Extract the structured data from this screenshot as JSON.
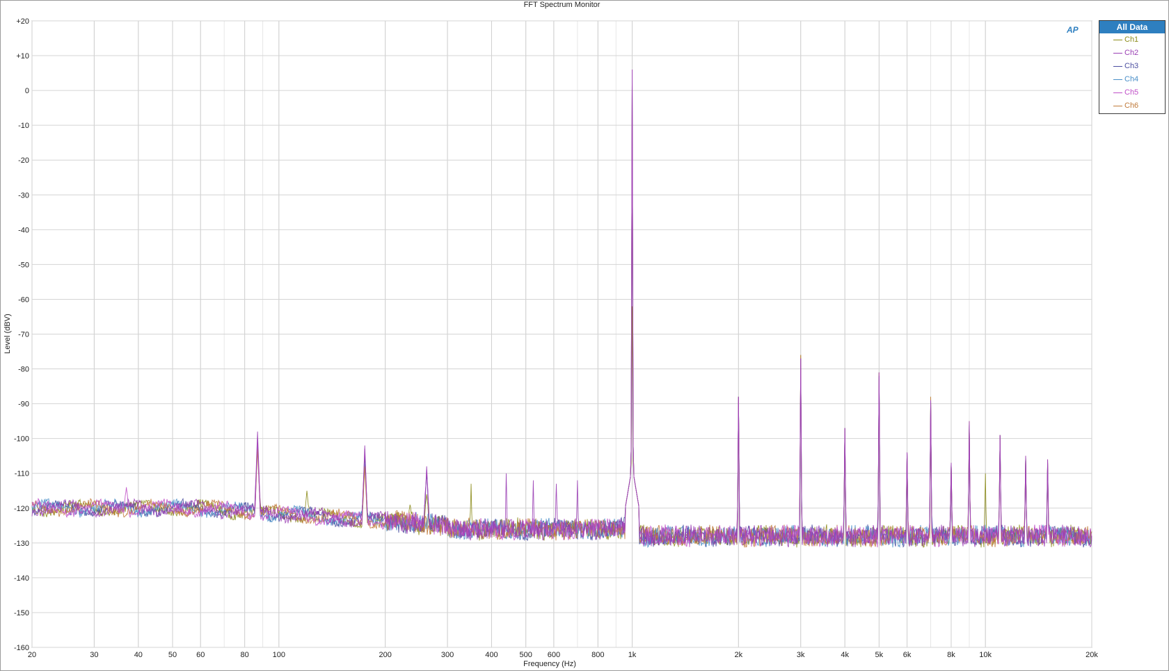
{
  "chart_data": {
    "type": "line",
    "title": "FFT Spectrum Monitor",
    "xlabel": "Frequency (Hz)",
    "ylabel": "Level (dBV)",
    "xscale": "log",
    "xlim": [
      20,
      20000
    ],
    "ylim": [
      -160,
      20
    ],
    "grid": true,
    "x_ticks": [
      20,
      30,
      40,
      50,
      60,
      80,
      100,
      200,
      300,
      400,
      500,
      600,
      800,
      1000,
      2000,
      3000,
      4000,
      5000,
      6000,
      8000,
      10000,
      20000
    ],
    "x_tick_labels": [
      "20",
      "30",
      "40",
      "50",
      "60",
      "80",
      "100",
      "200",
      "300",
      "400",
      "500",
      "600",
      "800",
      "1k",
      "2k",
      "3k",
      "4k",
      "5k",
      "6k",
      "8k",
      "10k",
      "20k"
    ],
    "y_ticks": [
      20,
      10,
      0,
      -10,
      -20,
      -30,
      -40,
      -50,
      -60,
      -70,
      -80,
      -90,
      -100,
      -110,
      -120,
      -130,
      -140,
      -150,
      -160
    ],
    "y_tick_labels": [
      "+20",
      "+10",
      "0",
      "-10",
      "-20",
      "-30",
      "-40",
      "-50",
      "-60",
      "-70",
      "-80",
      "-90",
      "-100",
      "-110",
      "-120",
      "-130",
      "-140",
      "-150",
      "-160"
    ],
    "legend": {
      "title": "All Data",
      "position": "top-right"
    },
    "noise_floor": {
      "low_freq": -120,
      "mid_freq": -126,
      "high_freq": -128
    },
    "series": [
      {
        "name": "Ch1",
        "color": "#8c8c1a",
        "fundamental_level": -62,
        "peaks": [
          [
            87,
            -102
          ],
          [
            120,
            -115
          ],
          [
            175,
            -106
          ],
          [
            235,
            -119
          ],
          [
            262,
            -116
          ],
          [
            350,
            -113
          ],
          [
            1000,
            -62
          ],
          [
            2000,
            -88
          ],
          [
            3000,
            -76
          ],
          [
            4000,
            -97
          ],
          [
            5000,
            -81
          ],
          [
            6000,
            -104
          ],
          [
            7000,
            -88
          ],
          [
            8000,
            -107
          ],
          [
            9000,
            -96
          ],
          [
            10000,
            -110
          ],
          [
            11000,
            -99
          ],
          [
            13000,
            -105
          ],
          [
            15000,
            -107
          ]
        ]
      },
      {
        "name": "Ch2",
        "color": "#9a3fb4",
        "fundamental_level": 6,
        "peaks": [
          [
            87,
            -98
          ],
          [
            175,
            -102
          ],
          [
            262,
            -108
          ],
          [
            440,
            -110
          ],
          [
            525,
            -112
          ],
          [
            610,
            -113
          ],
          [
            700,
            -112
          ],
          [
            1000,
            6
          ],
          [
            2000,
            -88
          ],
          [
            3000,
            -77
          ],
          [
            4000,
            -97
          ],
          [
            5000,
            -82
          ],
          [
            6000,
            -104
          ],
          [
            7000,
            -89
          ],
          [
            8000,
            -107
          ],
          [
            9000,
            -95
          ],
          [
            11000,
            -99
          ],
          [
            13000,
            -105
          ],
          [
            15000,
            -106
          ]
        ]
      },
      {
        "name": "Ch3",
        "color": "#4b4ea0",
        "fundamental_level": 5,
        "peaks": [
          [
            87,
            -101
          ],
          [
            175,
            -105
          ],
          [
            262,
            -110
          ],
          [
            1000,
            5
          ],
          [
            2000,
            -88
          ],
          [
            3000,
            -77
          ],
          [
            4000,
            -97
          ],
          [
            5000,
            -81
          ],
          [
            6000,
            -104
          ],
          [
            7000,
            -89
          ],
          [
            8000,
            -107
          ],
          [
            9000,
            -96
          ],
          [
            11000,
            -99
          ],
          [
            13000,
            -105
          ],
          [
            15000,
            -107
          ]
        ]
      },
      {
        "name": "Ch4",
        "color": "#4a8fc8",
        "fundamental_level": 5,
        "peaks": [
          [
            87,
            -102
          ],
          [
            175,
            -107
          ],
          [
            1000,
            5
          ],
          [
            2000,
            -88
          ],
          [
            3000,
            -77
          ],
          [
            4000,
            -97
          ],
          [
            5000,
            -81
          ],
          [
            6000,
            -104
          ],
          [
            7000,
            -89
          ],
          [
            8000,
            -107
          ],
          [
            9000,
            -96
          ],
          [
            11000,
            -99
          ],
          [
            13000,
            -105
          ],
          [
            15000,
            -107
          ]
        ]
      },
      {
        "name": "Ch5",
        "color": "#c04fc8",
        "fundamental_level": 6,
        "peaks": [
          [
            37,
            -114
          ],
          [
            87,
            -100
          ],
          [
            175,
            -103
          ],
          [
            262,
            -109
          ],
          [
            1000,
            6
          ],
          [
            2000,
            -88
          ],
          [
            3000,
            -77
          ],
          [
            4000,
            -97
          ],
          [
            5000,
            -81
          ],
          [
            6000,
            -104
          ],
          [
            7000,
            -89
          ],
          [
            8000,
            -107
          ],
          [
            9000,
            -96
          ],
          [
            11000,
            -99
          ],
          [
            13000,
            -105
          ],
          [
            15000,
            -106
          ]
        ]
      },
      {
        "name": "Ch6",
        "color": "#c07a3a",
        "fundamental_level": 6,
        "peaks": [
          [
            87,
            -103
          ],
          [
            175,
            -108
          ],
          [
            1000,
            6
          ],
          [
            2000,
            -88
          ],
          [
            3000,
            -76
          ],
          [
            4000,
            -97
          ],
          [
            5000,
            -81
          ],
          [
            6000,
            -104
          ],
          [
            7000,
            -88
          ],
          [
            8000,
            -107
          ],
          [
            9000,
            -95
          ],
          [
            11000,
            -99
          ],
          [
            13000,
            -105
          ],
          [
            15000,
            -106
          ]
        ]
      }
    ]
  }
}
